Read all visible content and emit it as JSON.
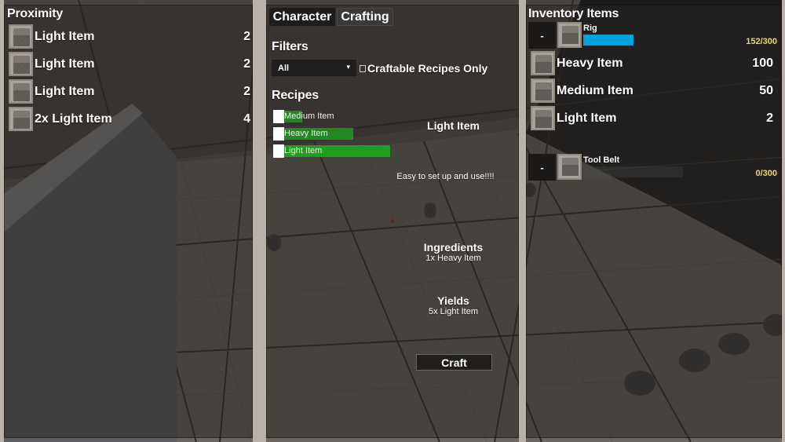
{
  "proximity": {
    "title": "Proximity",
    "items": [
      {
        "name": "Light Item",
        "count": "2"
      },
      {
        "name": "Light Item",
        "count": "2"
      },
      {
        "name": "Light Item",
        "count": "2"
      },
      {
        "name": "2x Light Item",
        "count": "4"
      }
    ]
  },
  "crafting": {
    "tabs": [
      {
        "label": "Character",
        "active": true
      },
      {
        "label": "Crafting",
        "active": false
      }
    ],
    "filters_title": "Filters",
    "filter_select": {
      "value": "All",
      "chevron": "▾"
    },
    "craftable_only": {
      "label": "Craftable Recipes Only",
      "checked": false
    },
    "recipes_title": "Recipes",
    "recipes": [
      {
        "name": "Medium Item",
        "progress": 0.17
      },
      {
        "name": "Heavy Item",
        "progress": 0.65
      },
      {
        "name": "Light Item",
        "progress": 1.0
      }
    ],
    "recipe_bar_color": "#1f9e1f",
    "selected": {
      "name": "Light Item",
      "description": "Easy to set up and use!!!!",
      "ingredients_title": "Ingredients",
      "ingredients": "1x Heavy Item",
      "yields_title": "Yields",
      "yields": "5x Light Item"
    },
    "craft_label": "Craft"
  },
  "inventory": {
    "title": "Inventory Items",
    "containers": [
      {
        "name": "Rig",
        "minus_label": "-",
        "capacity_text": "152/300",
        "capacity_fraction": 0.507,
        "fill_color": "#00a2dd",
        "items": [
          {
            "name": "Heavy Item",
            "count": "100"
          },
          {
            "name": "Medium Item",
            "count": "50"
          },
          {
            "name": "Light Item",
            "count": "2"
          }
        ]
      },
      {
        "name": "Tool Belt",
        "minus_label": "-",
        "capacity_text": "0/300",
        "capacity_fraction": 0,
        "fill_color": "#00a2dd",
        "items": []
      }
    ]
  }
}
